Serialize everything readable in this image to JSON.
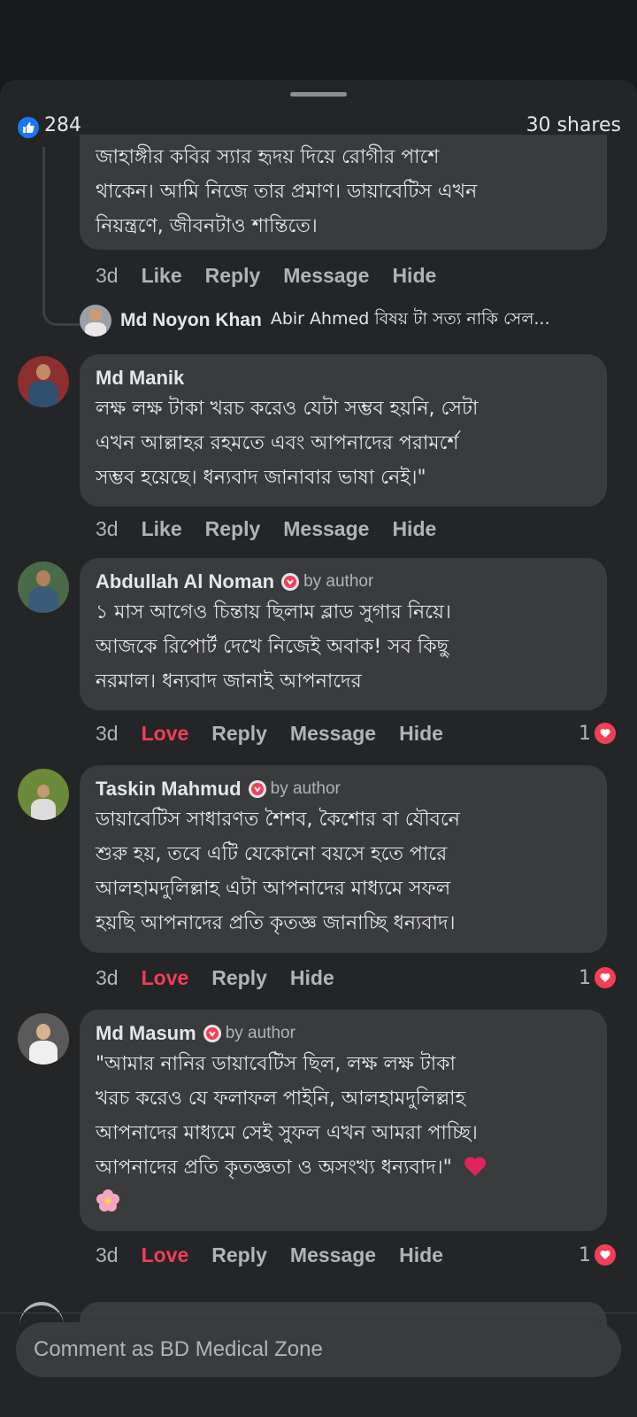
{
  "header": {
    "like_count": "284",
    "shares": "30 shares",
    "like_icon": "thumbs-up-icon",
    "accent": "#1877f2"
  },
  "comments": [
    {
      "text_lines": [
        "জাহাঙ্গীর কবির স্যার হৃদয় দিয়ে রোগীর পাশে",
        "থাকেন। আমি নিজে তার প্রমাণ। ডায়াবেটিস এখন",
        "নিয়ন্ত্রণে, জীবনটাও শান্তিতে।"
      ],
      "actions": {
        "time": "3d",
        "react": "Like",
        "reply": "Reply",
        "message": "Message",
        "hide": "Hide"
      }
    },
    {
      "name": "Md Manik",
      "text_lines": [
        "লক্ষ লক্ষ টাকা খরচ করেও যেটা সম্ভব হয়নি, সেটা",
        "এখন আল্লাহর রহমতে এবং আপনাদের পরামর্শে",
        "সম্ভব হয়েছে। ধন্যবাদ জানাবার ভাষা নেই।\""
      ],
      "actions": {
        "time": "3d",
        "react": "Like",
        "reply": "Reply",
        "message": "Message",
        "hide": "Hide"
      }
    },
    {
      "name": "Abdullah Al Noman",
      "badge": "by author",
      "text_lines": [
        "১ মাস আগেও চিন্তায় ছিলাম ব্লাড সুগার নিয়ে।",
        "আজকে রিপোর্ট দেখে নিজেই অবাক! সব কিছু",
        "নরমাল। ধন্যবাদ জানাই আপনাদের"
      ],
      "actions": {
        "time": "3d",
        "react": "Love",
        "reply": "Reply",
        "message": "Message",
        "hide": "Hide"
      },
      "reaction_count": "1"
    },
    {
      "name": "Taskin Mahmud",
      "badge": "by author",
      "text_lines": [
        "ডায়াবেটিস সাধারণত শৈশব, কৈশোর বা যৌবনে",
        "শুরু হয়, তবে এটি যেকোনো বয়সে হতে পারে",
        "আলহামদুলিল্লাহ এটা আপনাদের মাধ্যমে সফল",
        "হয়ছি আপনাদের প্রতি কৃতজ্ঞ জানাচ্ছি ধন্যবাদ।"
      ],
      "actions": {
        "time": "3d",
        "react": "Love",
        "reply": "Reply",
        "hide": "Hide"
      },
      "reaction_count": "1"
    },
    {
      "name": "Md Masum",
      "badge": "by author",
      "text_lines": [
        "\"আমার নানির ডায়াবেটিস ছিল, লক্ষ লক্ষ টাকা",
        "খরচ করেও যে ফলাফল পাইনি, আলহামদুলিল্লাহ",
        "আপনাদের মাধ্যমে সেই সুফল এখন আমরা পাচ্ছি।",
        "আপনাদের প্রতি কৃতজ্ঞতা ও অসংখ্য ধন্যবাদ।\""
      ],
      "emoji": [
        "heart-emoji",
        "flower-emoji"
      ],
      "actions": {
        "time": "3d",
        "react": "Love",
        "reply": "Reply",
        "message": "Message",
        "hide": "Hide"
      },
      "reaction_count": "1"
    }
  ],
  "reply_preview": {
    "name": "Md Noyon Khan",
    "text": "Abir Ahmed বিষয় টা সত্য নাকি সেল..."
  },
  "composer": {
    "placeholder": "Comment as BD Medical  Zone"
  },
  "colors": {
    "love": "#f33e58",
    "bubble": "#3a3b3c",
    "sheet": "#242526"
  }
}
